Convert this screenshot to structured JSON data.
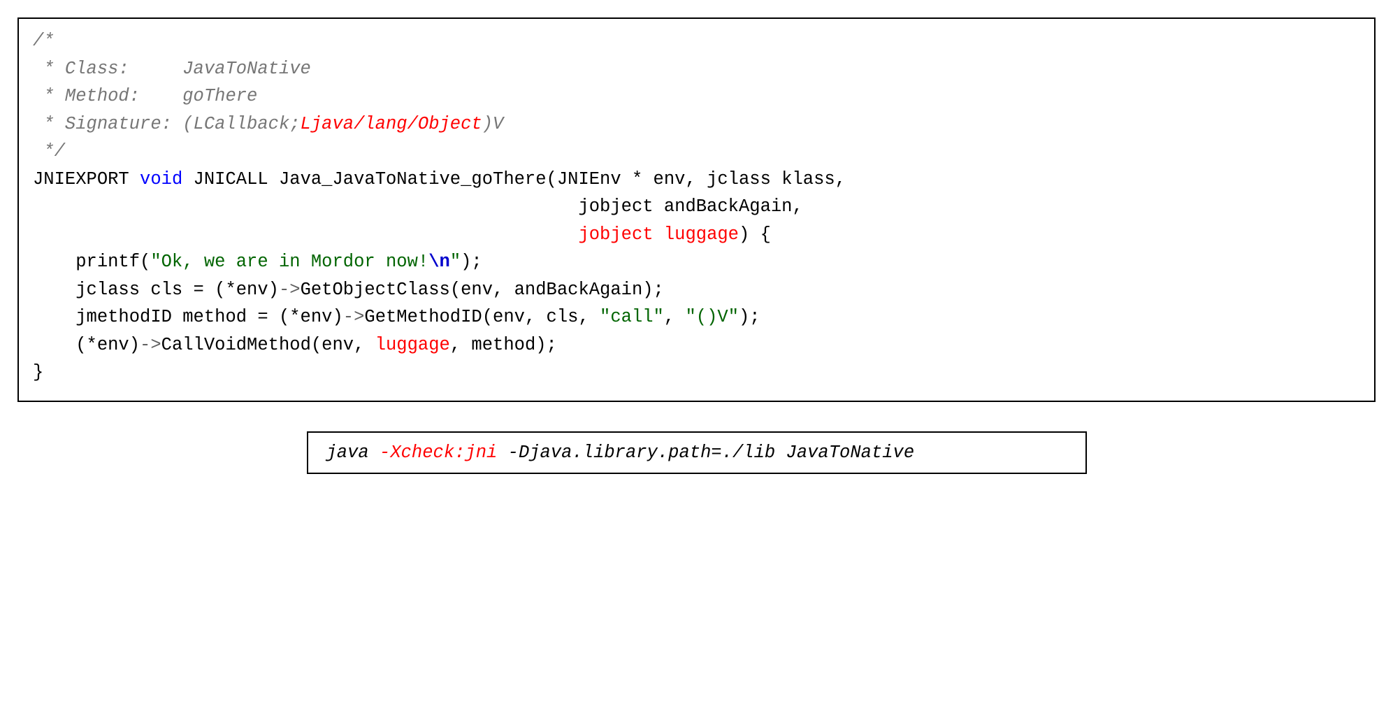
{
  "code": {
    "c1": "/*",
    "c2": " * Class:     JavaToNative",
    "c3": " * Method:    goThere",
    "c4a": " * Signature: (LCallback;",
    "c4b": "Ljava/lang/Object",
    "c4c": ")V",
    "c5": " */",
    "l6a": "JNIEXPORT ",
    "l6kw": "void",
    "l6b": " JNICALL Java_JavaToNative_goThere(JNIEnv * env, jclass klass,",
    "l7": "                                                   jobject andBackAgain,",
    "l8pad": "                                                   ",
    "l8red": "jobject luggage",
    "l8end": ") {",
    "l9a": "    printf(",
    "l9s1": "\"Ok, we are in Mordor now!",
    "l9esc": "\\n",
    "l9s2": "\"",
    "l9b": ");",
    "l10a": "    jclass cls = (*env)",
    "l10arr": "->",
    "l10b": "GetObjectClass(env, andBackAgain);",
    "l11a": "    jmethodID method = (*env)",
    "l11arr": "->",
    "l11b": "GetMethodID(env, cls, ",
    "l11s1": "\"call\"",
    "l11c": ", ",
    "l11s2": "\"()V\"",
    "l11d": ");",
    "l12a": "    (*env)",
    "l12arr": "->",
    "l12b": "CallVoidMethod(env, ",
    "l12red": "luggage",
    "l12c": ", method);",
    "l13": "}"
  },
  "command": {
    "p1": "java ",
    "red": "-Xcheck:jni",
    "p2": " -Djava.library.path=./lib JavaToNative"
  }
}
